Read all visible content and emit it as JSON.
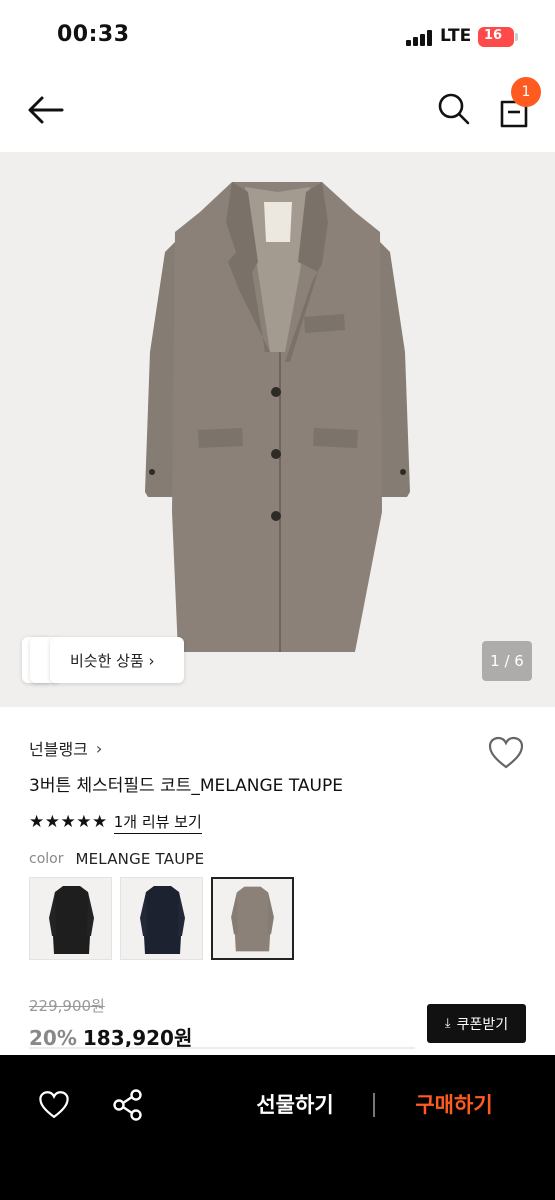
{
  "status_bar": {
    "time": "00:33",
    "network": "LTE",
    "battery": "16"
  },
  "header": {
    "cart_count": "1"
  },
  "gallery": {
    "similar_label": "비슷한 상품 ›",
    "page_indicator": "1 / 6"
  },
  "product": {
    "brand": "넌블랭크",
    "brand_chevron": "›",
    "title": "3버튼 체스터필드 코트_MELANGE TAUPE",
    "stars": "★★★★★",
    "review_link": "1개 리뷰 보기",
    "color_label": "color",
    "color_value": "MELANGE TAUPE",
    "swatches": [
      {
        "name": "black",
        "color": "#1e1e1e"
      },
      {
        "name": "navy",
        "color": "#1d2230"
      },
      {
        "name": "melange-taupe",
        "color": "#8b8178",
        "selected": true
      }
    ],
    "original_price": "229,900원",
    "discount": "20%",
    "sale_price": "183,920원",
    "coupon_icon": "⤓",
    "coupon_label": "쿠폰받기"
  },
  "bottom_bar": {
    "gift_label": "선물하기",
    "buy_label": "구매하기"
  },
  "colors": {
    "accent": "#ff5a1f",
    "coat": "#8b8178",
    "bar": "#000000"
  }
}
